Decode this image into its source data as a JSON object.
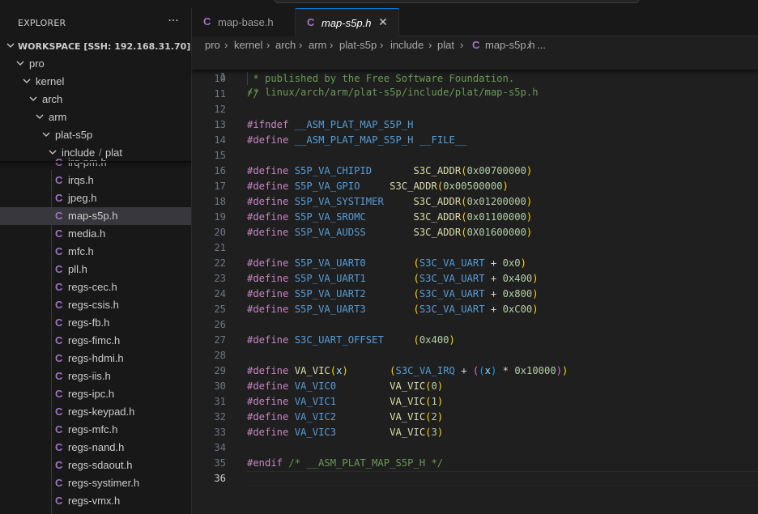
{
  "sidebar": {
    "title": "EXPLORER",
    "more": "···",
    "workspace": "WORKSPACE [SSH: 192.168.31.70]",
    "folders": [
      "pro",
      "kernel",
      "arch",
      "arm",
      "plat-s5p"
    ],
    "include_part1": "include",
    "include_sep": "/",
    "include_part2": "plat",
    "files": [
      "irq-pm.h",
      "irqs.h",
      "jpeg.h",
      "map-s5p.h",
      "media.h",
      "mfc.h",
      "pll.h",
      "regs-cec.h",
      "regs-csis.h",
      "regs-fb.h",
      "regs-fimc.h",
      "regs-hdmi.h",
      "regs-iis.h",
      "regs-ipc.h",
      "regs-keypad.h",
      "regs-mfc.h",
      "regs-nand.h",
      "regs-sdaout.h",
      "regs-systimer.h",
      "regs-vmx.h"
    ],
    "file_icon_letter": "C",
    "selected_file": "map-s5p.h"
  },
  "tabs": [
    {
      "label": "map-base.h",
      "icon_letter": "C",
      "active": false
    },
    {
      "label": "map-s5p.h",
      "icon_letter": "C",
      "active": true,
      "close": "✕"
    }
  ],
  "breadcrumb": {
    "items": [
      "pro",
      "kernel",
      "arch",
      "arm",
      "plat-s5p",
      "include",
      "plat"
    ],
    "file_icon_letter": "C",
    "file": "map-s5p.h",
    "tail": "...",
    "separator": "›"
  },
  "editor": {
    "sticky": {
      "num": "1",
      "text": "/* linux/arch/arm/plat-s5p/include/plat/map-s5p.h"
    },
    "line_numbers": [
      "10",
      "11",
      "12",
      "13",
      "14",
      "15",
      "16",
      "17",
      "18",
      "19",
      "20",
      "21",
      "22",
      "23",
      "24",
      "25",
      "26",
      "27",
      "28",
      "29",
      "30",
      "31",
      "32",
      "33",
      "34",
      "35",
      "36"
    ],
    "current_line": "36",
    "t": {
      "cm10": " * published by the Free Software Foundation.",
      "cm11": "*/",
      "ifndef": "#ifndef",
      "define": "#define",
      "endif": "#endif",
      "guard": "__ASM_PLAT_MAP_S5P_H",
      "file_macro": "__FILE__",
      "chipid": "S5P_VA_CHIPID",
      "gpio": "S5P_VA_GPIO",
      "systimer": "S5P_VA_SYSTIMER",
      "sromc": "S5P_VA_SROMC",
      "audss": "S5P_VA_AUDSS",
      "s3c_addr": "S3C_ADDR",
      "h16": "0x00700000",
      "h17": "0x00500000",
      "h18": "0x01200000",
      "h19": "0x01100000",
      "h20": "0X01600000",
      "uart0": "S5P_VA_UART0",
      "uart1": "S5P_VA_UART1",
      "uart2": "S5P_VA_UART2",
      "uart3": "S5P_VA_UART3",
      "s3c_va_uart": "S3C_VA_UART",
      "plus": "+",
      "u22": "0x0",
      "u23": "0x400",
      "u24": "0x800",
      "u25": "0xC00",
      "uart_offset": "S3C_UART_OFFSET",
      "h27": "0x400",
      "va_vic": "VA_VIC",
      "x": "x",
      "s3c_va_irq": "S3C_VA_IRQ",
      "star": "*",
      "h29": "0x10000",
      "vic0": "VA_VIC0",
      "vic1": "VA_VIC1",
      "vic2": "VA_VIC2",
      "vic3": "VA_VIC3",
      "n0": "0",
      "n1": "1",
      "n2": "2",
      "n3": "3",
      "lp": "(",
      "rp": ")",
      "endif_cm": "/* __ASM_PLAT_MAP_S5P_H */"
    }
  },
  "colors": {
    "accent": "#0078d4",
    "c_file_icon": "#a074c4",
    "comment": "#6a9955",
    "preprocessor": "#c586c0",
    "macro": "#569cd6"
  }
}
